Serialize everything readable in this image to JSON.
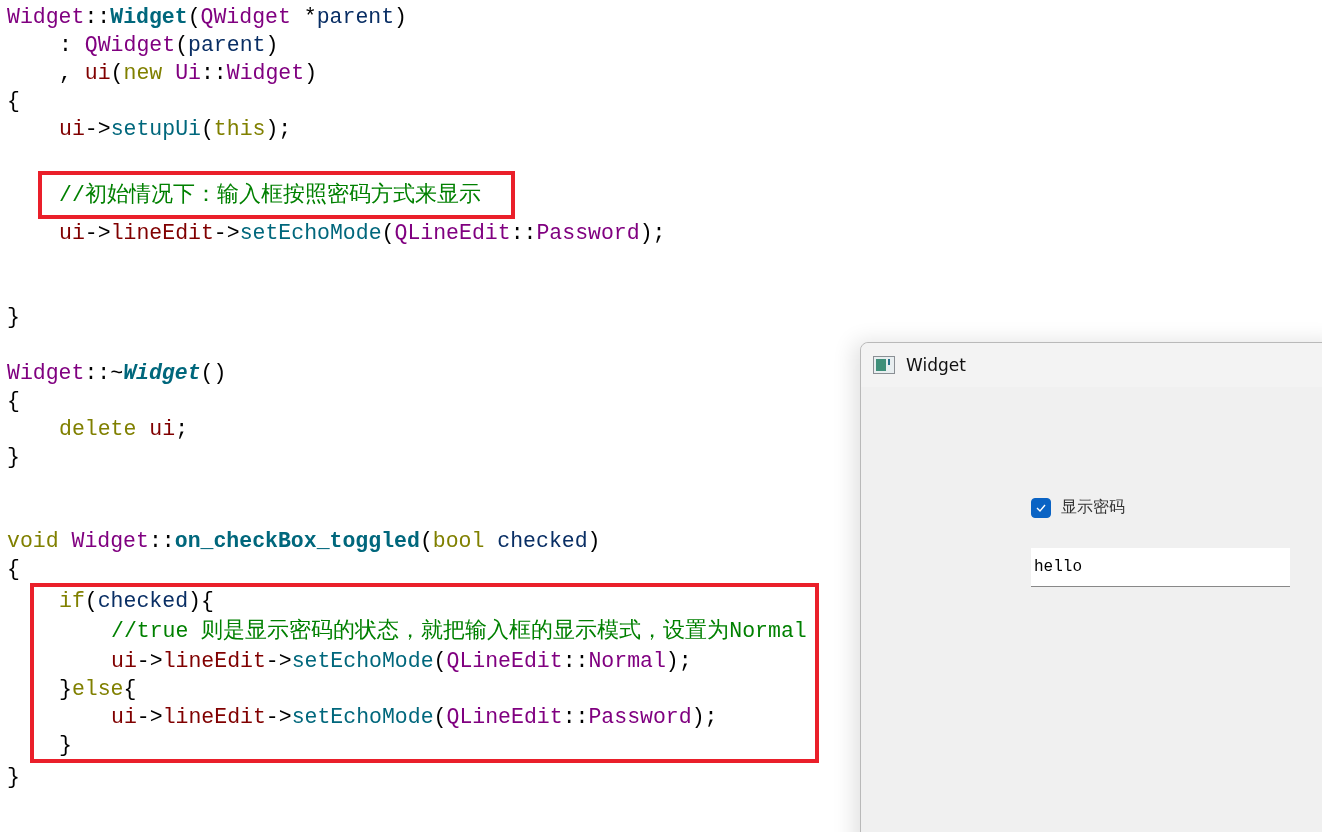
{
  "editor": {
    "lines": [
      {
        "kind": "code",
        "tokens": [
          {
            "kind": "type",
            "text": "Widget"
          },
          {
            "kind": "plain",
            "text": "::"
          },
          {
            "kind": "func",
            "text": "Widget"
          },
          {
            "kind": "plain",
            "text": "("
          },
          {
            "kind": "type",
            "text": "QWidget"
          },
          {
            "kind": "plain",
            "text": "*",
            "gap": true
          },
          {
            "kind": "param",
            "text": "parent"
          },
          {
            "kind": "plain",
            "text": ")"
          }
        ]
      },
      {
        "kind": "block",
        "lines": [
          {
            "kind": "code",
            "tokens": [
              {
                "kind": "plain",
                "text": ":"
              },
              {
                "kind": "type",
                "text": "QWidget",
                "gap": true
              },
              {
                "kind": "plain",
                "text": "("
              },
              {
                "kind": "param",
                "text": "parent"
              },
              {
                "kind": "plain",
                "text": ")"
              }
            ]
          },
          {
            "kind": "code",
            "tokens": [
              {
                "kind": "plain",
                "text": ","
              },
              {
                "kind": "member",
                "text": "ui",
                "gap": true
              },
              {
                "kind": "plain",
                "text": "("
              },
              {
                "kind": "keyword",
                "text": "new"
              },
              {
                "kind": "type",
                "text": "Ui",
                "gap": true
              },
              {
                "kind": "plain",
                "text": "::"
              },
              {
                "kind": "type",
                "text": "Widget"
              },
              {
                "kind": "plain",
                "text": ")"
              }
            ]
          }
        ]
      },
      {
        "kind": "code",
        "tokens": [
          {
            "kind": "plain",
            "text": "{"
          }
        ]
      },
      {
        "kind": "block",
        "lines": [
          {
            "kind": "code",
            "tokens": [
              {
                "kind": "member",
                "text": "ui"
              },
              {
                "kind": "plain",
                "text": "->"
              },
              {
                "kind": "method",
                "text": "setupUi"
              },
              {
                "kind": "plain",
                "text": "("
              },
              {
                "kind": "keyword",
                "text": "this"
              },
              {
                "kind": "plain",
                "text": ");"
              }
            ]
          },
          {
            "kind": "blank"
          },
          {
            "kind": "frame",
            "lines": [
              {
                "kind": "code",
                "tokens": [
                  {
                    "kind": "comment",
                    "text": "//初始情况下：输入框按照密码方式来显示"
                  }
                ]
              }
            ]
          },
          {
            "kind": "code",
            "tokens": [
              {
                "kind": "member",
                "text": "ui"
              },
              {
                "kind": "plain",
                "text": "->"
              },
              {
                "kind": "member",
                "text": "lineEdit"
              },
              {
                "kind": "plain",
                "text": "->"
              },
              {
                "kind": "method",
                "text": "setEchoMode"
              },
              {
                "kind": "plain",
                "text": "("
              },
              {
                "kind": "type",
                "text": "QLineEdit"
              },
              {
                "kind": "plain",
                "text": "::"
              },
              {
                "kind": "type",
                "text": "Password"
              },
              {
                "kind": "plain",
                "text": ");"
              }
            ]
          },
          {
            "kind": "blank"
          },
          {
            "kind": "blank"
          }
        ]
      },
      {
        "kind": "code",
        "tokens": [
          {
            "kind": "plain",
            "text": "}"
          }
        ]
      },
      {
        "kind": "blank"
      },
      {
        "kind": "code",
        "tokens": [
          {
            "kind": "type",
            "text": "Widget"
          },
          {
            "kind": "plain",
            "text": "::~"
          },
          {
            "kind": "func-italic",
            "text": "Widget"
          },
          {
            "kind": "plain",
            "text": "()"
          }
        ]
      },
      {
        "kind": "code",
        "tokens": [
          {
            "kind": "plain",
            "text": "{"
          }
        ]
      },
      {
        "kind": "block",
        "lines": [
          {
            "kind": "code",
            "tokens": [
              {
                "kind": "keyword",
                "text": "delete"
              },
              {
                "kind": "member",
                "text": "ui",
                "gap": true
              },
              {
                "kind": "plain",
                "text": ";"
              }
            ]
          }
        ]
      },
      {
        "kind": "code",
        "tokens": [
          {
            "kind": "plain",
            "text": "}"
          }
        ]
      },
      {
        "kind": "blank"
      },
      {
        "kind": "blank"
      },
      {
        "kind": "code",
        "tokens": [
          {
            "kind": "keyword",
            "text": "void"
          },
          {
            "kind": "type",
            "text": "Widget",
            "gap": true
          },
          {
            "kind": "plain",
            "text": "::"
          },
          {
            "kind": "func",
            "text": "on_checkBox_toggled"
          },
          {
            "kind": "plain",
            "text": "("
          },
          {
            "kind": "keyword",
            "text": "bool"
          },
          {
            "kind": "param",
            "text": "checked",
            "gap": true
          },
          {
            "kind": "plain",
            "text": ")"
          }
        ]
      },
      {
        "kind": "code",
        "tokens": [
          {
            "kind": "plain",
            "text": "{"
          }
        ]
      },
      {
        "kind": "frame",
        "lines": [
          {
            "kind": "block",
            "lines": [
              {
                "kind": "code",
                "tokens": [
                  {
                    "kind": "keyword",
                    "text": "if"
                  },
                  {
                    "kind": "plain",
                    "text": "("
                  },
                  {
                    "kind": "param",
                    "text": "checked"
                  },
                  {
                    "kind": "plain",
                    "text": "){"
                  }
                ]
              },
              {
                "kind": "block",
                "lines": [
                  {
                    "kind": "code",
                    "tokens": [
                      {
                        "kind": "comment",
                        "text": "//true 则是显示密码的状态，就把输入框的显示模式，设置为Normal"
                      }
                    ]
                  },
                  {
                    "kind": "code",
                    "tokens": [
                      {
                        "kind": "member",
                        "text": "ui"
                      },
                      {
                        "kind": "plain",
                        "text": "->"
                      },
                      {
                        "kind": "member",
                        "text": "lineEdit"
                      },
                      {
                        "kind": "plain",
                        "text": "->"
                      },
                      {
                        "kind": "method",
                        "text": "setEchoMode"
                      },
                      {
                        "kind": "plain",
                        "text": "("
                      },
                      {
                        "kind": "type",
                        "text": "QLineEdit"
                      },
                      {
                        "kind": "plain",
                        "text": "::"
                      },
                      {
                        "kind": "type",
                        "text": "Normal"
                      },
                      {
                        "kind": "plain",
                        "text": ");"
                      }
                    ]
                  }
                ]
              },
              {
                "kind": "code",
                "tokens": [
                  {
                    "kind": "plain",
                    "text": "}"
                  },
                  {
                    "kind": "keyword",
                    "text": "else"
                  },
                  {
                    "kind": "plain",
                    "text": "{"
                  }
                ]
              },
              {
                "kind": "block",
                "lines": [
                  {
                    "kind": "code",
                    "tokens": [
                      {
                        "kind": "member",
                        "text": "ui"
                      },
                      {
                        "kind": "plain",
                        "text": "->"
                      },
                      {
                        "kind": "member",
                        "text": "lineEdit"
                      },
                      {
                        "kind": "plain",
                        "text": "->"
                      },
                      {
                        "kind": "method",
                        "text": "setEchoMode"
                      },
                      {
                        "kind": "plain",
                        "text": "("
                      },
                      {
                        "kind": "type",
                        "text": "QLineEdit"
                      },
                      {
                        "kind": "plain",
                        "text": "::"
                      },
                      {
                        "kind": "type",
                        "text": "Password"
                      },
                      {
                        "kind": "plain",
                        "text": ");"
                      }
                    ]
                  }
                ]
              },
              {
                "kind": "code",
                "tokens": [
                  {
                    "kind": "plain",
                    "text": "}"
                  }
                ]
              }
            ]
          }
        ]
      },
      {
        "kind": "code",
        "tokens": [
          {
            "kind": "plain",
            "text": "}"
          }
        ]
      }
    ]
  },
  "window": {
    "title": "Widget",
    "checkbox": {
      "label": "显示密码",
      "checked": true
    },
    "line_edit": {
      "value": "hello"
    }
  }
}
